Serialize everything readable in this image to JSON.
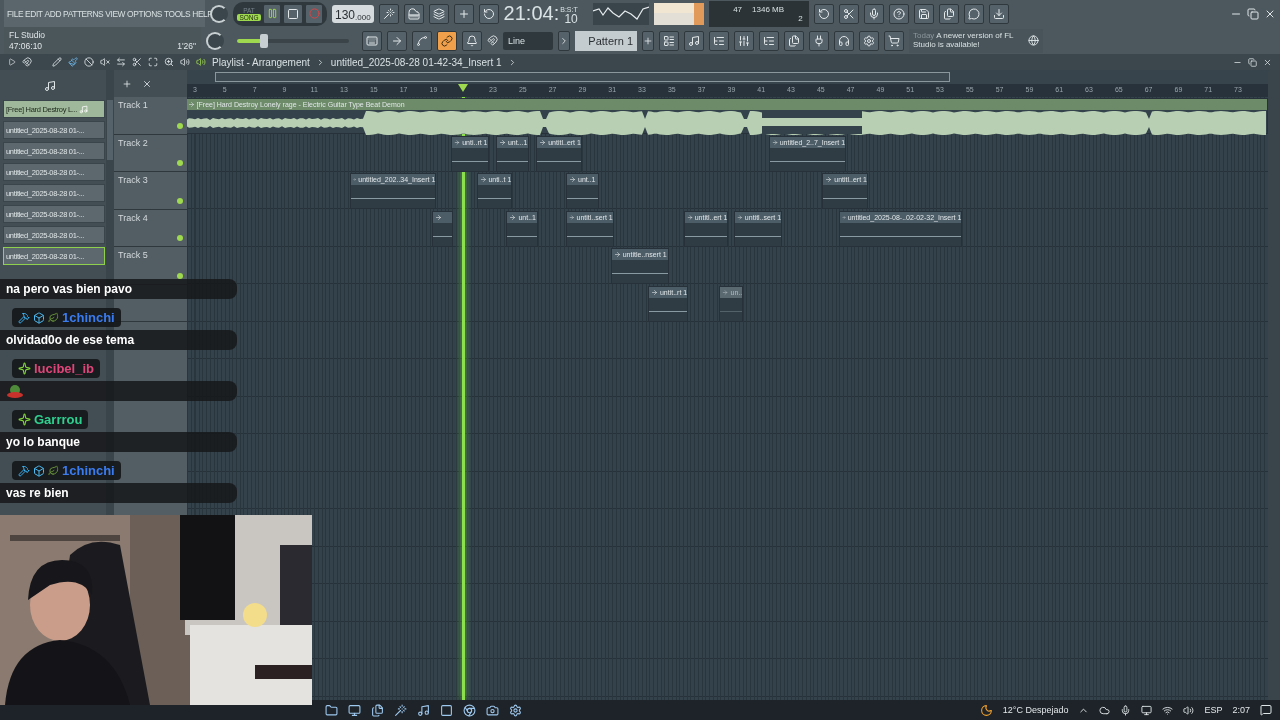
{
  "menu": [
    "FILE",
    "EDIT",
    "ADD",
    "PATTERNS",
    "VIEW",
    "OPTIONS",
    "TOOLS",
    "HELP"
  ],
  "hint": {
    "title": "FL Studio",
    "time": "47:06:10",
    "length": "1'26\""
  },
  "transport": {
    "modes": [
      {
        "label": "PAT",
        "selected": false
      },
      {
        "label": "SONG",
        "selected": true
      }
    ],
    "playing": true,
    "tempo": "130",
    "tempo_decimals": ".000"
  },
  "clock": {
    "time": "21:04:",
    "seconds": "10",
    "unit": "B:S:T"
  },
  "monitor": {
    "cpu": "47",
    "memory": "1346 MB",
    "polyphony": "2"
  },
  "master": {
    "level": 0.24
  },
  "snap": {
    "value": "Line"
  },
  "pattern": {
    "name": "Pattern 1"
  },
  "news": {
    "date": "Today",
    "message": "A newer version of FL Studio is available!"
  },
  "playlist": {
    "title": "Playlist - Arrangement",
    "path": "untitled_2025-08-28 01-42-34_Insert 1"
  },
  "picker": [
    {
      "kind": "audio",
      "label": "[Free] Hard Destroy L...",
      "selected": false
    },
    {
      "kind": "clip",
      "label": "untitled_2025-08-28 01-...",
      "selected": false
    },
    {
      "kind": "clip",
      "label": "untitled_2025-08-28 01-...",
      "selected": false
    },
    {
      "kind": "clip",
      "label": "untitled_2025-08-28 01-...",
      "selected": false
    },
    {
      "kind": "clip",
      "label": "untitled_2025-08-28 01-...",
      "selected": false
    },
    {
      "kind": "clip",
      "label": "untitled_2025-08-28 01-...",
      "selected": false
    },
    {
      "kind": "clip",
      "label": "untitled_2025-08-28 01-...",
      "selected": false
    },
    {
      "kind": "clip",
      "label": "untitled_2025-08-28 01-...",
      "selected": true
    }
  ],
  "ruler": [
    "3",
    "5",
    "7",
    "9",
    "11",
    "13",
    "15",
    "17",
    "19",
    "23",
    "25",
    "27",
    "29",
    "31",
    "33",
    "35",
    "37",
    "39",
    "41",
    "43",
    "45",
    "47",
    "49",
    "51",
    "53",
    "55",
    "57",
    "59",
    "61",
    "63",
    "65",
    "67",
    "69",
    "71",
    "73"
  ],
  "tracks": [
    {
      "name": "Track 1",
      "clips": [
        {
          "kind": "audio",
          "label": "[Free] Hard Destroy Lonely rage - Electric Guitar Type Beat Demon"
        }
      ]
    },
    {
      "name": "Track 2",
      "clips": [
        {
          "kind": "pattern",
          "label": "unti..rt 1",
          "muted": false
        },
        {
          "kind": "pattern",
          "label": "unt...1",
          "muted": false
        },
        {
          "kind": "pattern",
          "label": "untitl..ert 1",
          "muted": false
        },
        {
          "kind": "pattern",
          "label": "untitled_2..7_Insert 1",
          "muted": false
        }
      ]
    },
    {
      "name": "Track 3",
      "clips": [
        {
          "kind": "pattern",
          "label": "untitled_202..34_Insert 1",
          "muted": false
        },
        {
          "kind": "pattern",
          "label": "unti..t 1",
          "muted": false
        },
        {
          "kind": "pattern",
          "label": "unt..1",
          "muted": false
        },
        {
          "kind": "pattern",
          "label": "untitl..ert 1",
          "muted": false
        }
      ]
    },
    {
      "name": "Track 4",
      "clips": [
        {
          "kind": "pattern",
          "muted": false
        },
        {
          "kind": "pattern",
          "label": "unt..1",
          "muted": false
        },
        {
          "kind": "pattern",
          "label": "untitl..sert 1",
          "muted": false
        },
        {
          "kind": "pattern",
          "label": "untitl..ert 1",
          "muted": false
        },
        {
          "kind": "pattern",
          "label": "untitl..sert 1",
          "muted": false
        },
        {
          "kind": "pattern",
          "label": "untitled_2025-08-..02-02-32_Insert 1",
          "muted": false
        }
      ]
    },
    {
      "name": "Track 5",
      "clips": [
        {
          "kind": "pattern",
          "label": "untitle..nsert 1",
          "muted": false
        }
      ]
    },
    {
      "clips": [
        {
          "kind": "pattern",
          "label": "untit..rt 1",
          "muted": false
        },
        {
          "kind": "pattern",
          "label": "un..",
          "muted": true
        }
      ]
    }
  ],
  "chat": [
    {
      "kind": "message",
      "text": "na pero vas bien pavo"
    },
    {
      "kind": "user",
      "name": "1chinchi",
      "color": "#3a7cf0",
      "moderator": true
    },
    {
      "kind": "message",
      "text": "olvidad0o de ese tema"
    },
    {
      "kind": "user",
      "name": "lucibel_ib",
      "color": "#e0457a",
      "moderator": false
    },
    {
      "kind": "emote"
    },
    {
      "kind": "user",
      "name": "Garrrou",
      "color": "#2ecf8f",
      "moderator": false
    },
    {
      "kind": "message",
      "text": "yo lo banque"
    },
    {
      "kind": "user",
      "name": "1chinchi",
      "color": "#3a7cf0",
      "moderator": true
    },
    {
      "kind": "message",
      "text": "vas re bien"
    }
  ],
  "webcam": {
    "kind": "picture"
  },
  "taskbar": {
    "weather": "12°C Despejado",
    "language": "ESP",
    "time": "2:07"
  }
}
